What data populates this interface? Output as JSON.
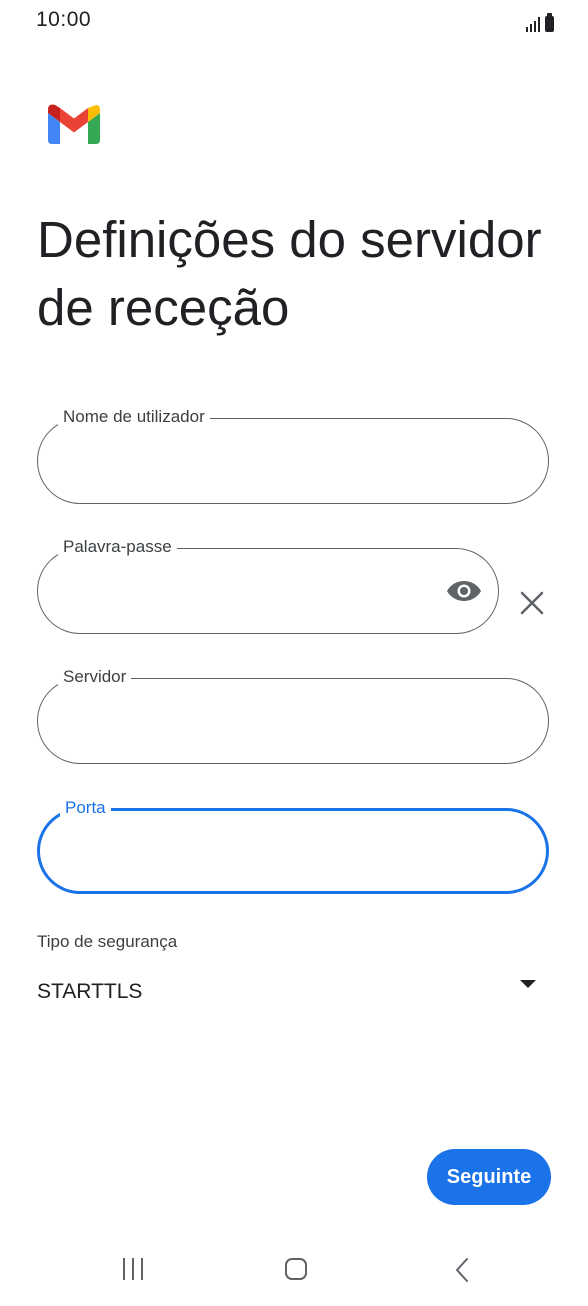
{
  "status_bar": {
    "time": "10:00"
  },
  "app": {
    "logo_icon": "gmail-logo-icon",
    "brand_colors": {
      "red": "#ea4335",
      "blue": "#4285f4",
      "green": "#34a853",
      "yellow": "#fbbc04",
      "dark_red": "#c5221f"
    }
  },
  "page": {
    "title": "Definições do servidor de receção"
  },
  "form": {
    "username": {
      "label": "Nome de utilizador",
      "value": ""
    },
    "password": {
      "label": "Palavra-passe",
      "value": "",
      "visibility_icon": "eye-icon",
      "clear_icon": "close-icon"
    },
    "server": {
      "label": "Servidor",
      "value": ""
    },
    "port": {
      "label": "Porta",
      "value": "",
      "focused": true
    }
  },
  "security": {
    "label": "Tipo de segurança",
    "selected": "STARTTLS",
    "dropdown_icon": "dropdown-arrow-icon"
  },
  "actions": {
    "next_label": "Seguinte"
  },
  "nav_bar": {
    "recent_icon": "recent-apps-icon",
    "home_icon": "home-icon",
    "back_icon": "back-icon"
  },
  "colors": {
    "accent": "#1a73e8",
    "outline": "#5f6368",
    "text": "#202124"
  }
}
